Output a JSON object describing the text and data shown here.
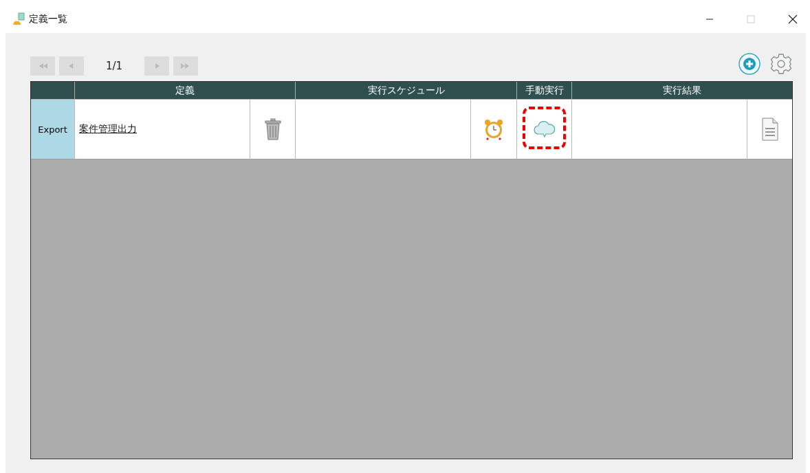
{
  "window": {
    "title": "定義一覧"
  },
  "pager": {
    "buttons": [
      {
        "kind": "first",
        "disabled": true
      },
      {
        "kind": "prev",
        "disabled": true
      },
      {
        "kind": "next",
        "disabled": true
      },
      {
        "kind": "last",
        "disabled": true
      }
    ],
    "page": "1/1"
  },
  "table": {
    "columns": [
      {
        "label": "定義"
      },
      {
        "label": "実行スケジュール"
      },
      {
        "label": "手動実行"
      },
      {
        "label": "実行結果"
      }
    ],
    "rows": [
      {
        "type": "Export",
        "name": "案件管理出力",
        "manual_run_highlighted": true
      }
    ]
  }
}
